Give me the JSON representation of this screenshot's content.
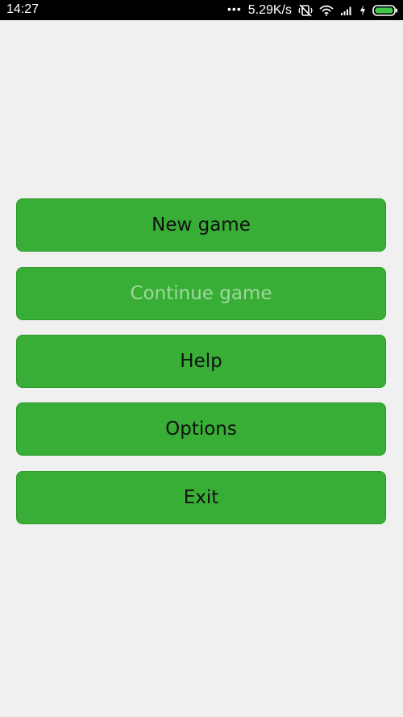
{
  "status_bar": {
    "time": "14:27",
    "dots": "•••",
    "network_speed": "5.29K/s",
    "icons": [
      "vibrate-off-icon",
      "wifi-icon",
      "signal-icon",
      "charging-icon",
      "battery-icon"
    ]
  },
  "menu": {
    "new_game": "New game",
    "continue_game": "Continue game",
    "help": "Help",
    "options": "Options",
    "exit": "Exit"
  },
  "colors": {
    "button_green": "#38ae36",
    "disabled_text": "#9fd89c",
    "background": "#f0f0f0"
  }
}
